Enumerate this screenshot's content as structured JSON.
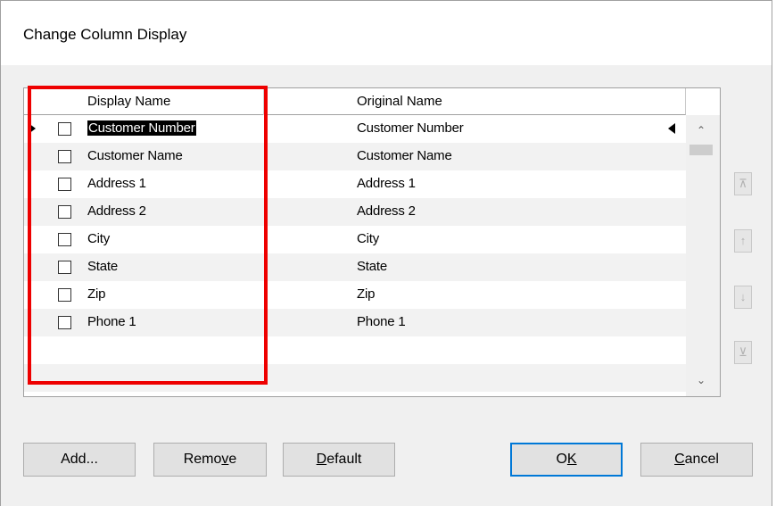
{
  "window": {
    "title": "Change Column Display"
  },
  "grid": {
    "columns": [
      "Display Name",
      "Original Name"
    ],
    "rows": [
      {
        "display": "Customer Number",
        "original": "Customer Number",
        "checked": false,
        "current": true
      },
      {
        "display": "Customer Name",
        "original": "Customer Name",
        "checked": false
      },
      {
        "display": "Address 1",
        "original": "Address 1",
        "checked": false
      },
      {
        "display": "Address 2",
        "original": "Address 2",
        "checked": false
      },
      {
        "display": "City",
        "original": "City",
        "checked": false
      },
      {
        "display": "State",
        "original": "State",
        "checked": false
      },
      {
        "display": "Zip",
        "original": "Zip",
        "checked": false
      },
      {
        "display": "Phone 1",
        "original": "Phone 1",
        "checked": false
      }
    ]
  },
  "side_buttons": [
    {
      "icon": "move-to-top-icon"
    },
    {
      "icon": "move-up-icon"
    },
    {
      "icon": "move-down-icon"
    },
    {
      "icon": "move-to-bottom-icon"
    }
  ],
  "buttons": {
    "add": "Add...",
    "remove_pre": "Remo",
    "remove_ul": "v",
    "remove_post": "e",
    "default_ul": "D",
    "default_post": "efault",
    "ok_pre": "O",
    "ok_ul": "K",
    "cancel_ul": "C",
    "cancel_post": "ancel"
  },
  "colors": {
    "highlight": "#ee0000",
    "default_button_border": "#0078d7"
  }
}
